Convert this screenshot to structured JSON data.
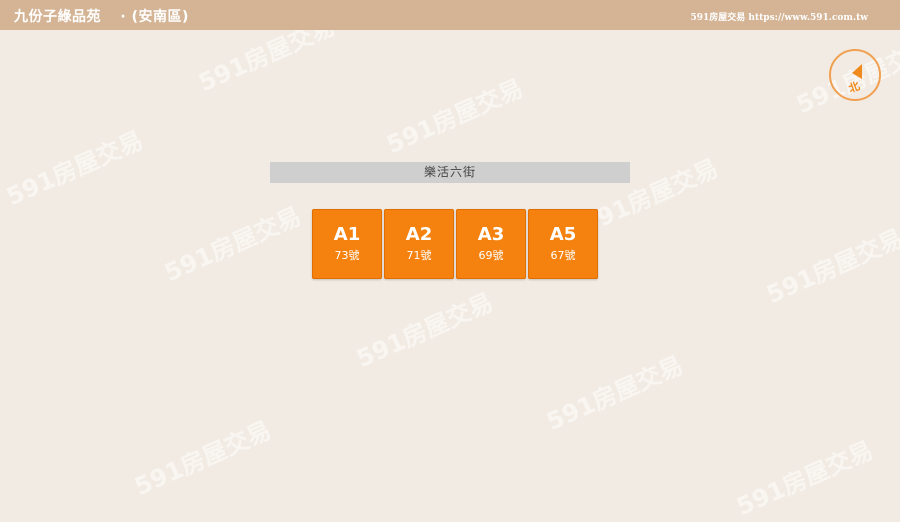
{
  "header": {
    "title": "九份子綠品苑",
    "separator": "·",
    "district": "(安南區)",
    "source": "591房屋交易 https://www.591.com.tw"
  },
  "compass": {
    "label": "北",
    "icon": "north-arrow-icon"
  },
  "street": {
    "name": "樂活六街"
  },
  "units": [
    {
      "code": "A1",
      "number": "73號"
    },
    {
      "code": "A2",
      "number": "71號"
    },
    {
      "code": "A3",
      "number": "69號"
    },
    {
      "code": "A5",
      "number": "67號"
    }
  ],
  "watermark": {
    "text": "591房屋交易"
  },
  "colors": {
    "header": "#d4b494",
    "background": "#f2ebe4",
    "unit": "#f5820f",
    "street": "#cfcfcf",
    "compass": "#f0a050"
  }
}
